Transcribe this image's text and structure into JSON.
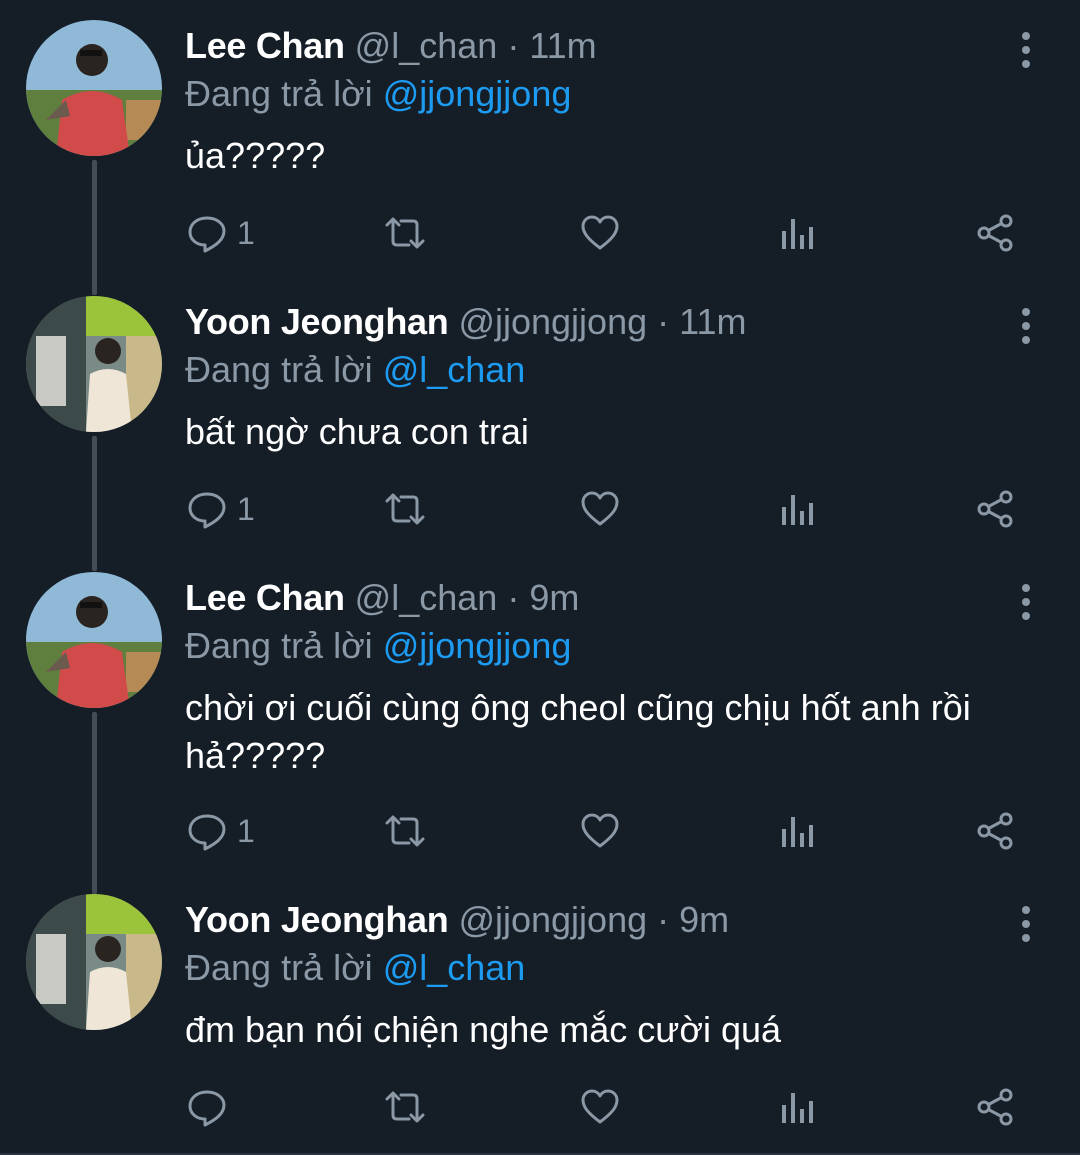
{
  "reply_prefix": "Đang trả lời",
  "colors": {
    "background": "#151d27",
    "text": "#ffffff",
    "secondary": "#8b98a5",
    "accent": "#1d9bf0",
    "thread_line": "#434c57"
  },
  "tweets": [
    {
      "name": "Lee Chan",
      "handle": "@l_chan",
      "time": "11m",
      "replying_to": "@jjongjjong",
      "text": "ủa?????",
      "reply_count": "1",
      "avatar": "avatar-lee-chan"
    },
    {
      "name": "Yoon Jeonghan",
      "handle": "@jjongjjong",
      "time": "11m",
      "replying_to": "@l_chan",
      "text": "bất ngờ chưa con trai",
      "reply_count": "1",
      "avatar": "avatar-yoon-jeonghan"
    },
    {
      "name": "Lee Chan",
      "handle": "@l_chan",
      "time": "9m",
      "replying_to": "@jjongjjong",
      "text": "chời ơi cuối cùng ông cheol cũng chịu hốt anh rồi hả?????",
      "reply_count": "1",
      "avatar": "avatar-lee-chan"
    },
    {
      "name": "Yoon Jeonghan",
      "handle": "@jjongjjong",
      "time": "9m",
      "replying_to": "@l_chan",
      "text": "đm bạn nói chiện nghe mắc cười quá",
      "reply_count": "",
      "avatar": "avatar-yoon-jeonghan"
    }
  ]
}
